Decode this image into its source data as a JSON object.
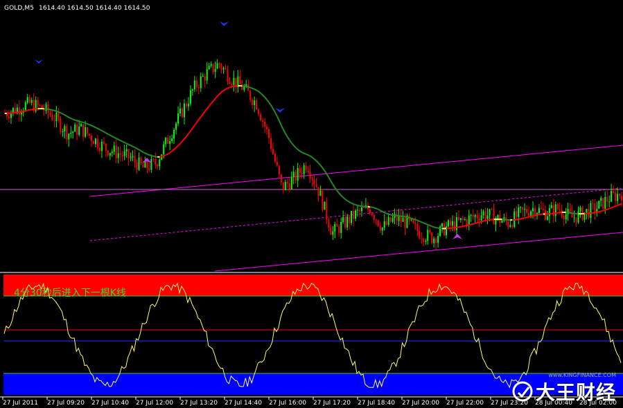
{
  "header": {
    "symbol": "GOLD,M5",
    "ohlc": "1614.40 1614.50 1614.40 1614.50"
  },
  "indicator_message": "4分30秒后进入下一根K线",
  "watermark": {
    "text": "大王财经",
    "url_text": "www.KINGFINANCE.COM"
  },
  "time_axis": [
    "27 Jul 2011",
    "27 Jul 09:20",
    "27 Jul 10:40",
    "27 Jul 12:00",
    "27 Jul 13:20",
    "27 Jul 14:40",
    "27 Jul 16:00",
    "27 Jul 17:20",
    "27 Jul 18:40",
    "27 Jul 20:00",
    "27 Jul 22:00",
    "27 Jul 23:20",
    "28 Jul 00:40",
    "28 Jul 02:00"
  ],
  "colors": {
    "background": "#000000",
    "bull_candle": "#00ff00",
    "bear_candle": "#ff0000",
    "channel": "#ff00ff",
    "ma_green": "#228b22",
    "ma_red": "#ff0000",
    "ma_yellow": "#ffff66",
    "osc_line": "#ffff66",
    "overbought_zone": "#ff0000",
    "oversold_zone": "#0000ff",
    "level_green": "#33cc33"
  },
  "chart_data": {
    "type": "candlestick",
    "title": "GOLD,M5",
    "series": [
      {
        "name": "close",
        "values": [
          1620,
          1621,
          1622,
          1621,
          1619,
          1616,
          1617,
          1615,
          1613,
          1612,
          1611,
          1609,
          1610,
          1615,
          1620,
          1625,
          1628,
          1630,
          1627,
          1625,
          1622,
          1615,
          1605,
          1607,
          1610,
          1604,
          1596,
          1598,
          1600,
          1601,
          1597,
          1599,
          1598,
          1596,
          1595,
          1597,
          1598,
          1599,
          1600,
          1599,
          1598,
          1600,
          1601,
          1600,
          1601,
          1599,
          1600,
          1601,
          1603,
          1604
        ]
      }
    ],
    "signal_arrows": [
      "down",
      "down",
      "down",
      "up",
      "up"
    ],
    "oscillator": {
      "overbought_level": 80,
      "oversold_level": 20,
      "upper_band": 55,
      "lower_band": 45
    }
  }
}
